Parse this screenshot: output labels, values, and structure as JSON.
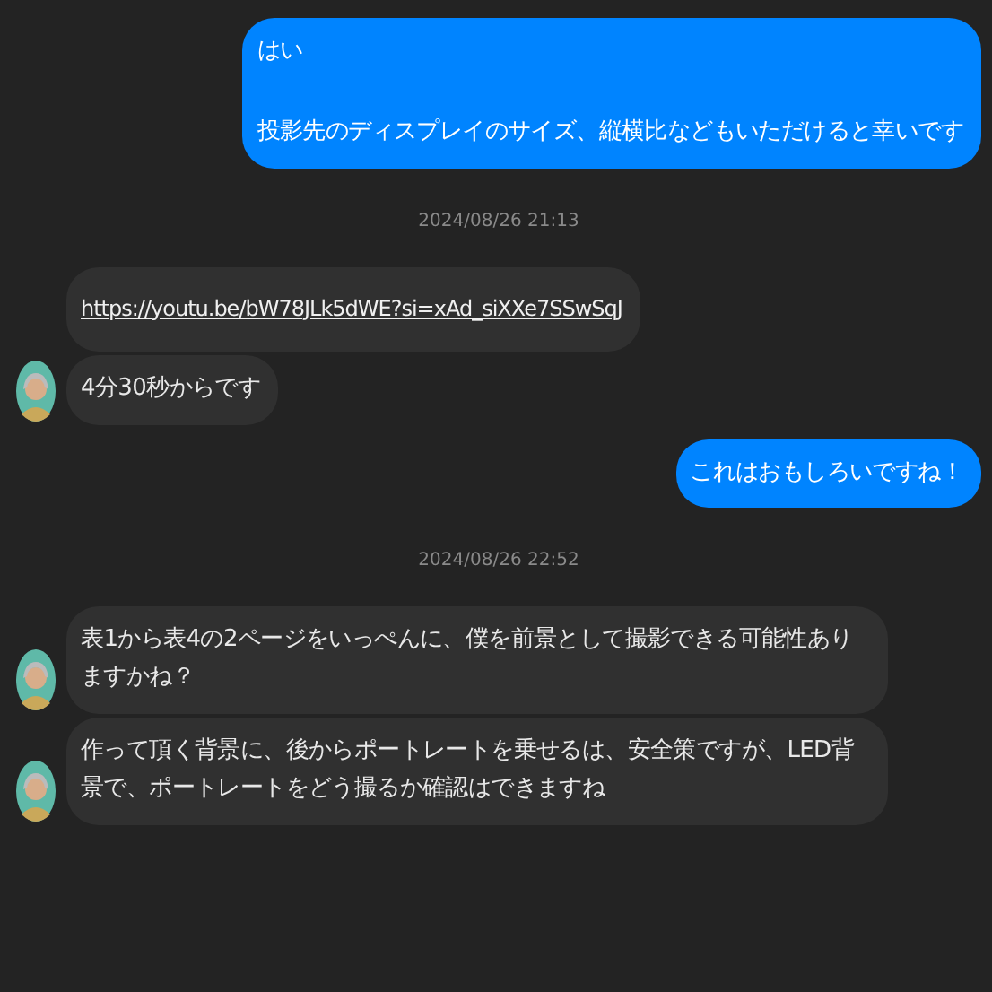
{
  "messages": [
    {
      "kind": "sent",
      "paragraphs": [
        "はい",
        "投影先のディスプレイのサイズ、縦横比などもいただけると幸いです"
      ]
    },
    {
      "kind": "timestamp",
      "text": "2024/08/26 21:13"
    },
    {
      "kind": "link",
      "avatar": false,
      "paragraphs": [
        "https://youtu.be/bW78JLk5dWE?si=xAd_siXXe7SSwSqJ"
      ]
    },
    {
      "kind": "received",
      "avatar": true,
      "paragraphs": [
        "4分30秒からです"
      ]
    },
    {
      "kind": "sent",
      "paragraphs": [
        "これはおもしろいですね！"
      ]
    },
    {
      "kind": "timestamp",
      "text": "2024/08/26 22:52"
    },
    {
      "kind": "received",
      "avatar": true,
      "paragraphs": [
        "表1から表4の2ページをいっぺんに、僕を前景として撮影できる可能性ありますかね？"
      ]
    },
    {
      "kind": "received",
      "avatar": true,
      "paragraphs": [
        "作って頂く背景に、後からポートレートを乗せるは、安全策ですが、LED背景で、ポートレートをどう撮るか確認はできますね"
      ]
    }
  ]
}
